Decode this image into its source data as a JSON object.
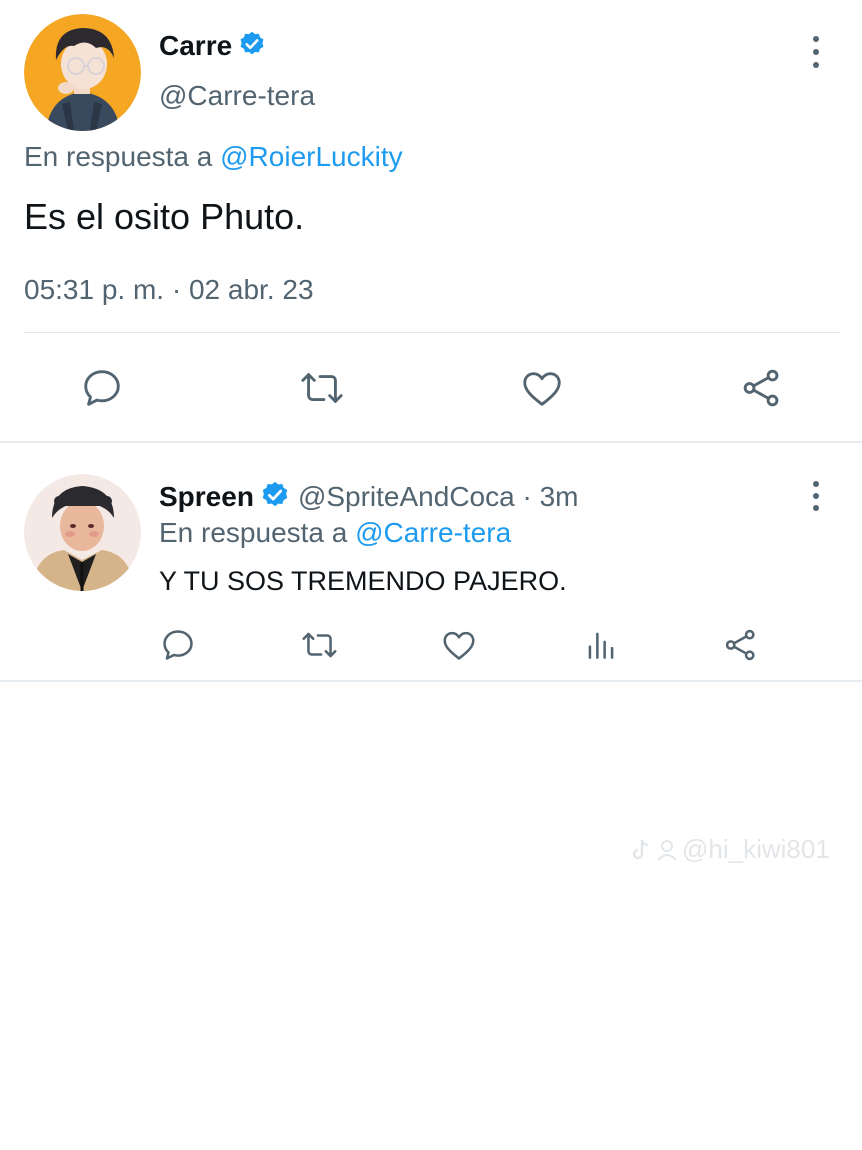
{
  "main_tweet": {
    "author_name": "Carre",
    "author_handle": "@Carre-tera",
    "reply_prefix": "En respuesta a",
    "reply_to": "@RoierLuckity",
    "text": "Es el osito Phuto.",
    "timestamp": "05:31 p. m. · 02 abr. 23",
    "actions": [
      "reply-icon",
      "retweet-icon",
      "like-icon",
      "share-icon"
    ]
  },
  "reply_tweet": {
    "author_name": "Spreen",
    "author_handle": "@SpriteAndCoca · 3m",
    "reply_prefix": "En respuesta a",
    "reply_to": "@Carre-tera",
    "text": "Y TU SOS TREMENDO PAJERO.",
    "actions": [
      "reply-icon",
      "retweet-icon",
      "like-icon",
      "analytics-icon",
      "share-icon"
    ]
  },
  "watermark": {
    "text": "@hi_kiwi801"
  },
  "colors": {
    "accent": "#1d9bf0",
    "text_primary": "#0f1419",
    "text_secondary": "#536471",
    "icon": "#536471",
    "verified": "#1d9bf0",
    "divider": "#e7ecf0"
  }
}
